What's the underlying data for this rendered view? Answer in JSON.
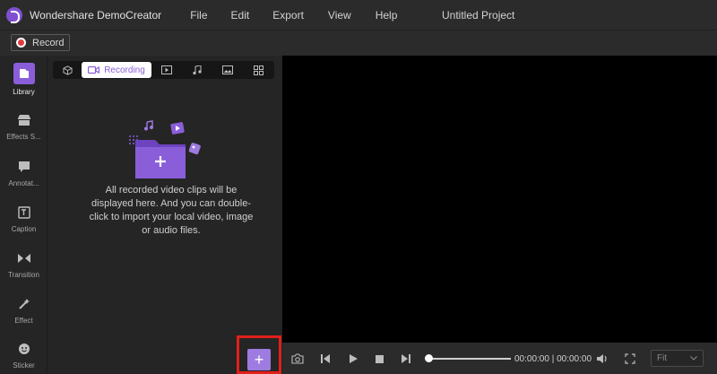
{
  "app": {
    "name": "Wondershare DemoCreator",
    "project_title": "Untitled Project"
  },
  "menu": [
    {
      "label": "File"
    },
    {
      "label": "Edit"
    },
    {
      "label": "Export"
    },
    {
      "label": "View"
    },
    {
      "label": "Help"
    }
  ],
  "recordbar": {
    "record_label": "Record"
  },
  "rail": {
    "items": [
      {
        "label": "Library",
        "icon": "library-icon"
      },
      {
        "label": "Effects S...",
        "icon": "store-icon"
      },
      {
        "label": "Annotat...",
        "icon": "annotation-icon"
      },
      {
        "label": "Caption",
        "icon": "caption-icon"
      },
      {
        "label": "Transition",
        "icon": "transition-icon"
      },
      {
        "label": "Effect",
        "icon": "magic-wand-icon"
      },
      {
        "label": "Sticker",
        "icon": "sticker-icon"
      }
    ]
  },
  "library": {
    "tabs": [
      {
        "label": "",
        "icon": "cube-icon"
      },
      {
        "label": "Recording",
        "icon": "video-camera-icon"
      },
      {
        "label": "",
        "icon": "play-media-icon"
      },
      {
        "label": "",
        "icon": "music-note-icon"
      },
      {
        "label": "",
        "icon": "image-icon"
      },
      {
        "label": "",
        "icon": "grid-icon"
      }
    ],
    "empty_text": "All recorded video clips will be displayed here. And you can double-click to import your local video, image or audio files.",
    "add_symbol": "+"
  },
  "player": {
    "timecode": "00:00:00 | 00:00:00",
    "fit_label": "Fit"
  },
  "colors": {
    "accent": "#8a5ed9",
    "record": "#e23b3b",
    "highlight_frame": "#e0201a"
  }
}
